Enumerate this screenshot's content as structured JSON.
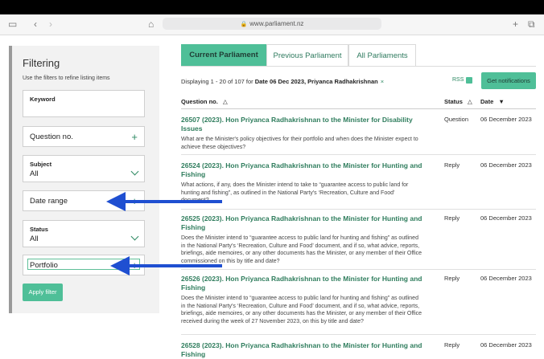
{
  "browser": {
    "url": "www.parliament.nz",
    "icons": [
      "sidebar-icon",
      "back-icon",
      "forward-icon",
      "home-icon",
      "new-tab-icon",
      "tabs-icon"
    ]
  },
  "sidebar": {
    "title": "Filtering",
    "hint": "Use the filters to refine listing items",
    "keyword_label": "Keyword",
    "question_no_label": "Question no.",
    "subject_label": "Subject",
    "subject_value": "All",
    "date_range_label": "Date range",
    "status_label": "Status",
    "status_value": "All",
    "portfolio_label": "Portfolio",
    "apply_label": "Apply filter"
  },
  "tabs": [
    "Current Parliament",
    "Previous Parliament",
    "All Parliaments"
  ],
  "listing": {
    "displaying_prefix": "Displaying 1 - 20 of 107 for ",
    "displaying_filter": "Date 06 Dec 2023, Priyanca Radhakrishnan",
    "clear": "×",
    "rss": "RSS",
    "notifications": "Get notifications"
  },
  "table": {
    "headers": {
      "question": "Question no.",
      "status": "Status",
      "date": "Date"
    },
    "sort_icons": {
      "question": "△",
      "status": "△",
      "date": "▼"
    },
    "rows": [
      {
        "title": "26507 (2023). Hon Priyanca Radhakrishnan to the Minister for Disability Issues",
        "desc": "What are the Minister's policy objectives for their portfolio and when does the Minister expect to achieve these objectives?",
        "status": "Question",
        "date": "06 December 2023"
      },
      {
        "title": "26524 (2023). Hon Priyanca Radhakrishnan to the Minister for Hunting and Fishing",
        "desc": "What actions, if any, does the Minister intend to take to “guarantee access to public land for hunting and fishing”, as outlined in the National Party's ‘Recreation, Culture and Food’ document?",
        "status": "Reply",
        "date": "06 December 2023"
      },
      {
        "title": "26525 (2023). Hon Priyanca Radhakrishnan to the Minister for Hunting and Fishing",
        "desc": "Does the Minister intend to “guarantee access to public land for hunting and fishing” as outlined in the National Party's ‘Recreation, Culture and Food’ document, and if so, what advice, reports, briefings, aide memoires, or any other documents has the Minister, or any member of their Office commissioned on this by title and date?",
        "status": "Reply",
        "date": "06 December 2023"
      },
      {
        "title": "26526 (2023). Hon Priyanca Radhakrishnan to the Minister for Hunting and Fishing",
        "desc": "Does the Minister intend to “guarantee access to public land for hunting and fishing” as outlined in the National Party's ‘Recreation, Culture and Food’ document, and if so, what advice, reports, briefings, aide memoires, or any other documents has the Minister, or any member of their Office received during the week of 27 November 2023, on this by title and date?",
        "status": "Reply",
        "date": "06 December 2023"
      },
      {
        "title": "26528 (2023). Hon Priyanca Radhakrishnan to the Minister for Hunting and Fishing",
        "desc": "",
        "status": "Reply",
        "date": "06 December 2023"
      }
    ]
  },
  "colors": {
    "accent": "#4fbf98",
    "link": "#2f7d5d",
    "arrow": "#1f4fd1"
  }
}
